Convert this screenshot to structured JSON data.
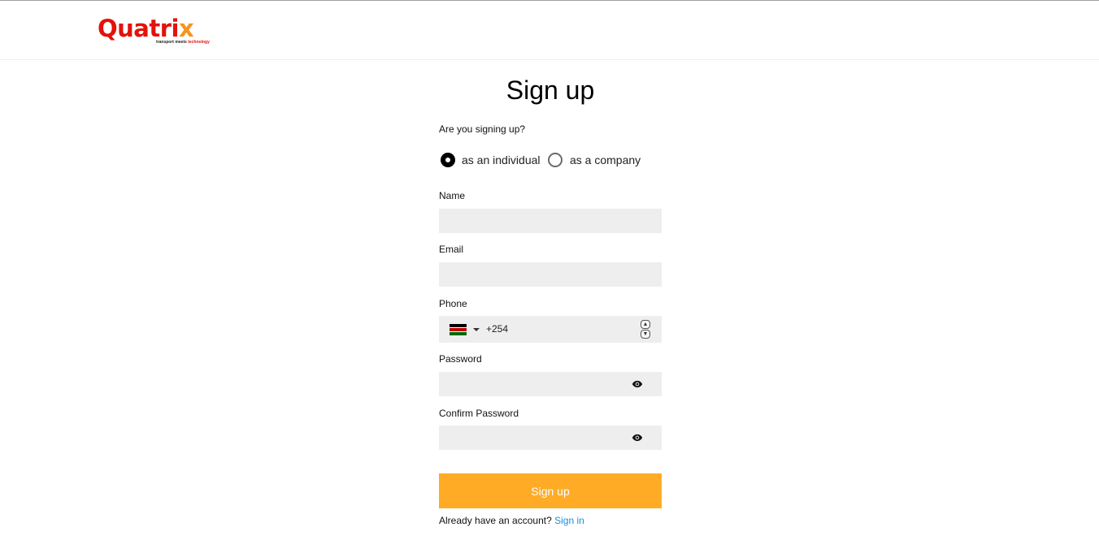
{
  "header": {
    "logo": {
      "word_main": "Quatri",
      "word_accent": "x",
      "tagline_main": "transport meets ",
      "tagline_accent": "technology"
    }
  },
  "form": {
    "title": "Sign up",
    "question": "Are you signing up?",
    "account_type": {
      "options": [
        {
          "label": "as an individual",
          "checked": true
        },
        {
          "label": "as a company",
          "checked": false
        }
      ]
    },
    "name": {
      "label": "Name",
      "value": ""
    },
    "email": {
      "label": "Email",
      "value": ""
    },
    "phone": {
      "label": "Phone",
      "country_flag": "kenya-flag-icon",
      "code": "+254"
    },
    "password": {
      "label": "Password",
      "value": "",
      "toggle_icon": "eye-icon"
    },
    "confirm_password": {
      "label": "Confirm Password",
      "value": "",
      "toggle_icon": "eye-icon"
    },
    "submit_label": "Sign up",
    "footer_text": "Already have an account?",
    "signin_link": "Sign in"
  },
  "colors": {
    "accent": "#ffab26",
    "link": "#1a8fd8",
    "brand_red": "#e3120b",
    "brand_orange": "#f7941d",
    "field_bg": "#eeeeee"
  }
}
